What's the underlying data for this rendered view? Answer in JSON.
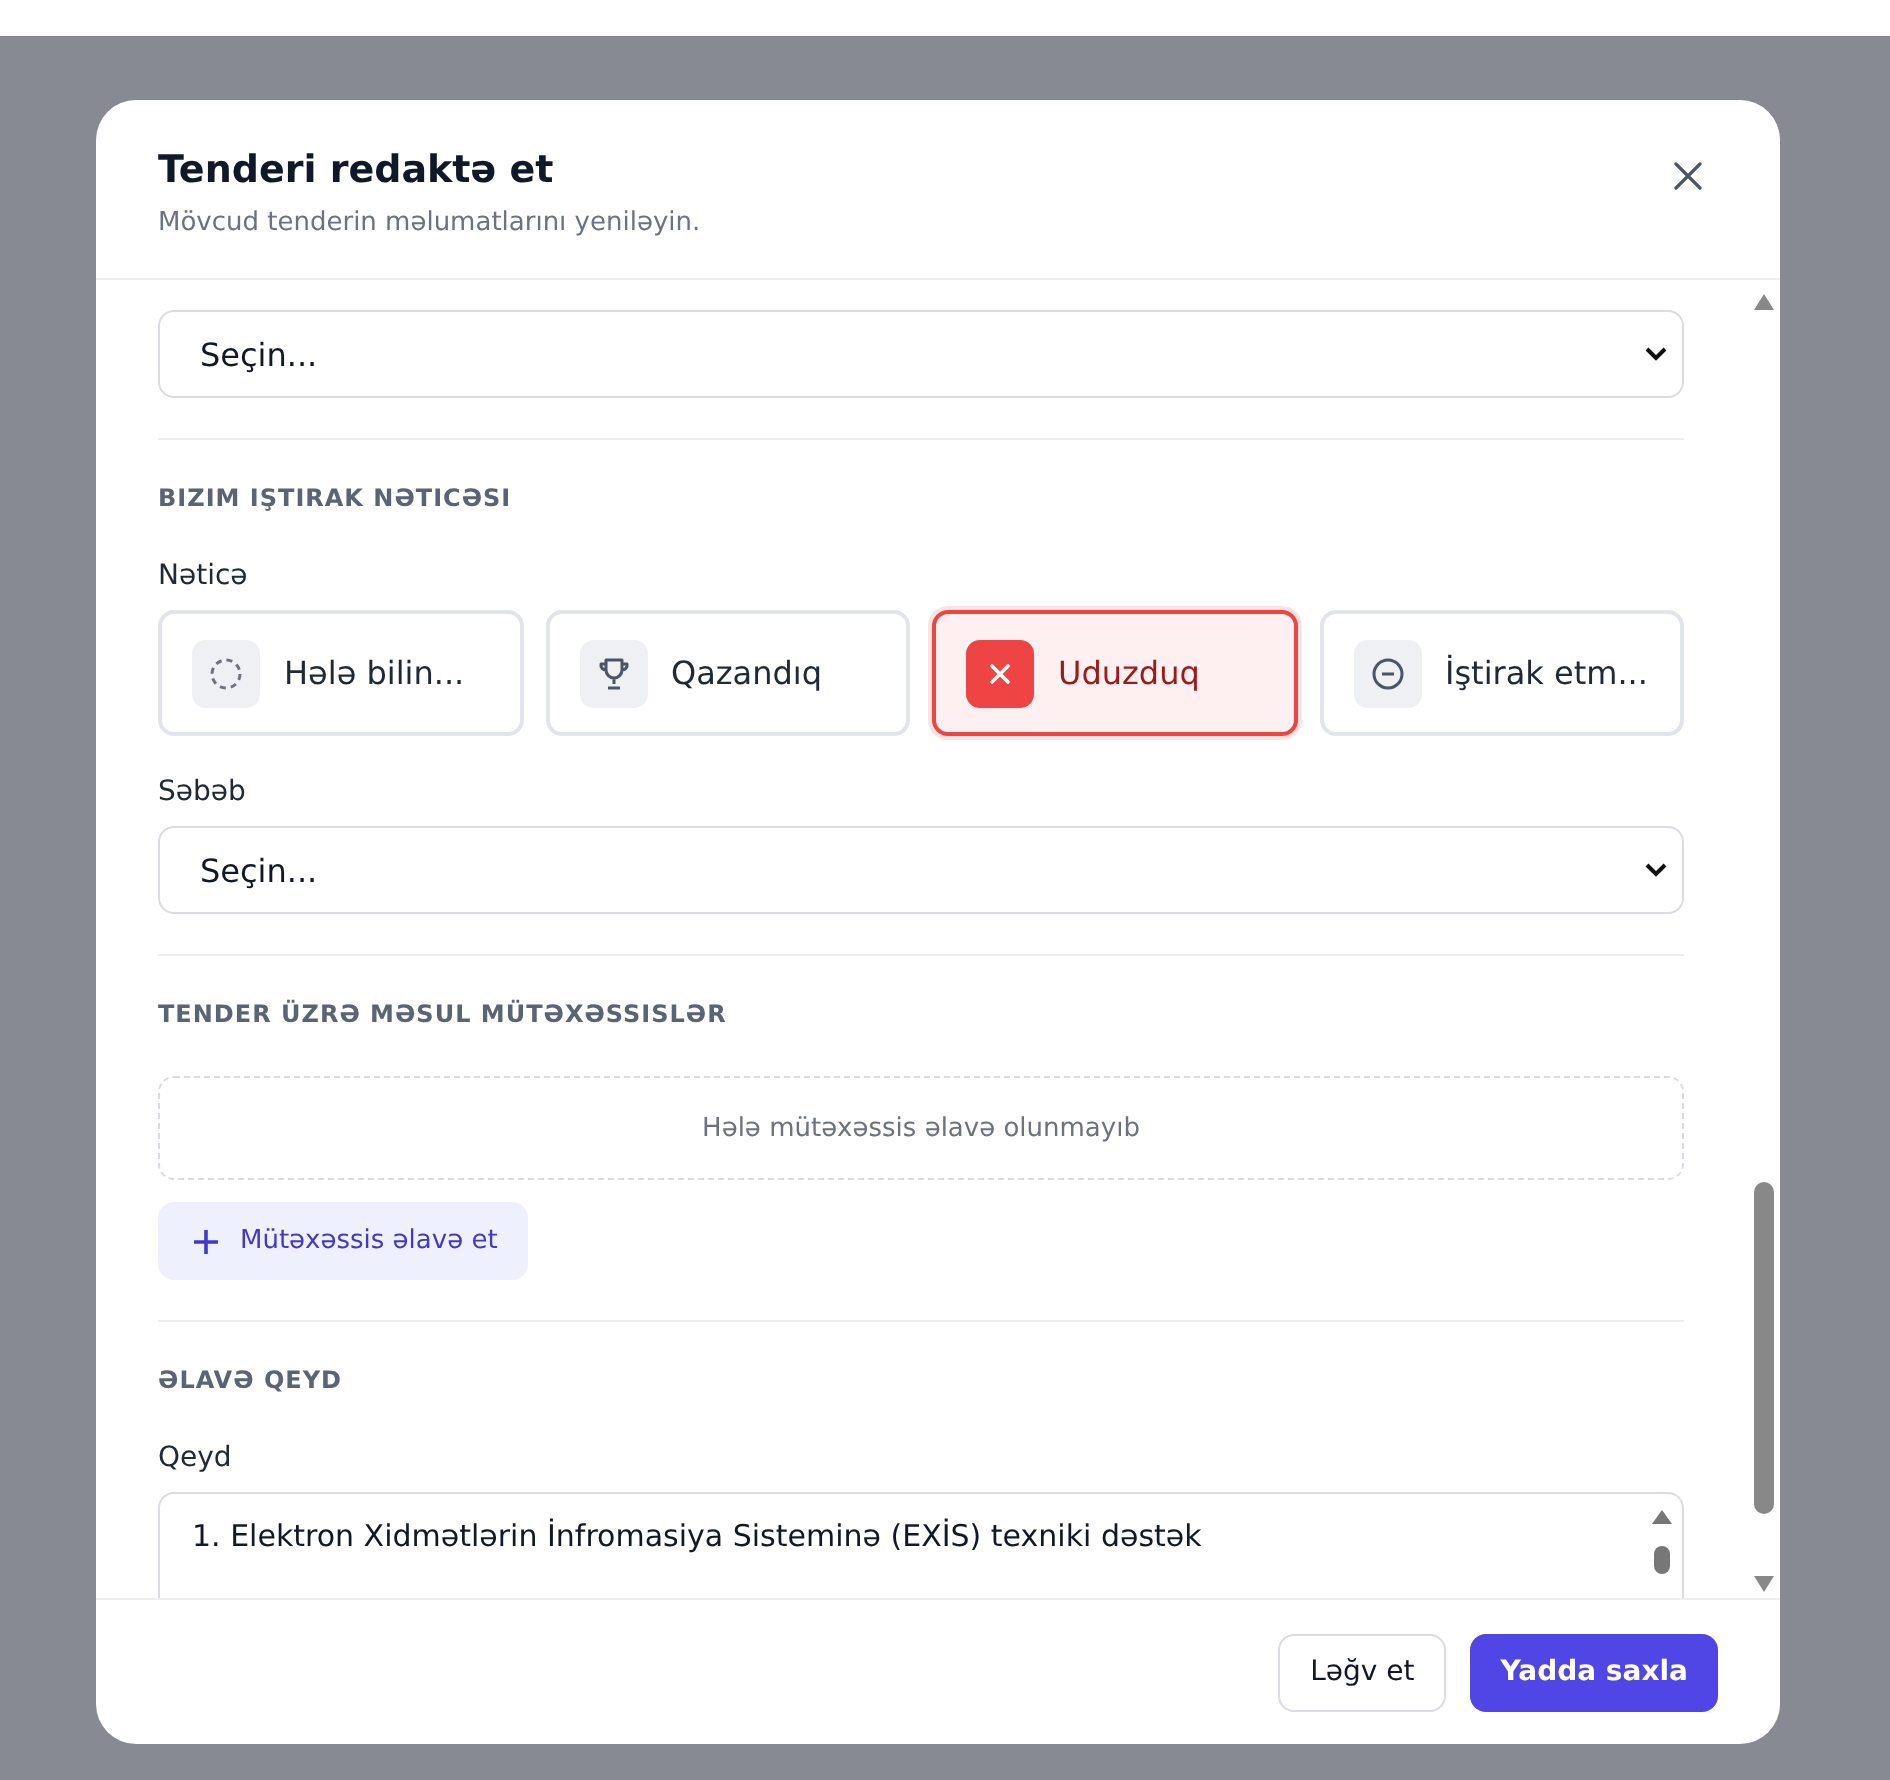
{
  "dialog": {
    "title": "Tenderi redaktə et",
    "subtitle": "Mövcud tenderin məlumatlarını yeniləyin."
  },
  "contract_select": {
    "value": "Seçin..."
  },
  "result_section": {
    "heading": "BIZIM IŞTIRAK NƏTICƏSI",
    "label": "Nəticə",
    "options": [
      {
        "kind": "pending",
        "label": "Hələ bilin...",
        "selected": false
      },
      {
        "kind": "won",
        "label": "Qazandıq",
        "selected": false
      },
      {
        "kind": "lost",
        "label": "Uduzduq",
        "selected": true
      },
      {
        "kind": "skipped",
        "label": "İştirak etm...",
        "selected": false
      }
    ],
    "reason_label": "Səbəb",
    "reason_value": "Seçin..."
  },
  "specialists_section": {
    "heading": "TENDER ÜZRƏ MƏSUL MÜTƏXƏSSISLƏR",
    "empty_text": "Hələ mütəxəssis əlavə olunmayıb",
    "add_button": "Mütəxəssis əlavə et"
  },
  "note_section": {
    "heading": "ƏLAVƏ QEYD",
    "label": "Qeyd",
    "value": "1. Elektron Xidmətlərin İnfromasiya Sisteminə (EXİS) texniki dəstək"
  },
  "buttons": {
    "cancel": "Ləğv et",
    "save": "Yadda saxla"
  }
}
